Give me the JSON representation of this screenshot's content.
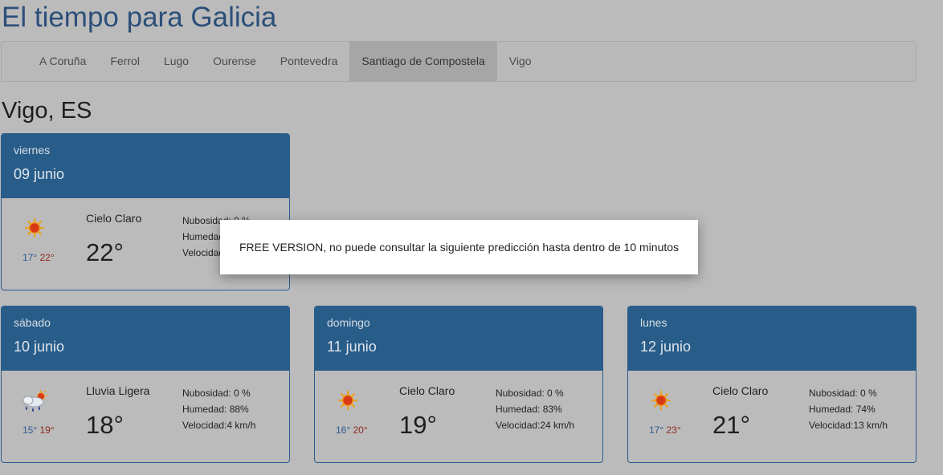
{
  "header": {
    "title": "El tiempo para Galicia"
  },
  "nav": {
    "items": [
      {
        "label": "A Coruña",
        "active": false
      },
      {
        "label": "Ferrol",
        "active": false
      },
      {
        "label": "Lugo",
        "active": false
      },
      {
        "label": "Ourense",
        "active": false
      },
      {
        "label": "Pontevedra",
        "active": false
      },
      {
        "label": "Santiago de Compostela",
        "active": true
      },
      {
        "label": "Vigo",
        "active": false
      }
    ]
  },
  "city": {
    "title": "Vigo, ES"
  },
  "forecast": [
    {
      "weekday": "viernes",
      "date": "09 junio",
      "icon": "sun-icon",
      "min": "17°",
      "max": "22°",
      "condition": "Cielo Claro",
      "temp": "22°",
      "nubosidad": "Nubosidad: 0 %",
      "humedad": "Humedad: ",
      "velocidad": "Velocidad: "
    },
    {
      "weekday": "sábado",
      "date": "10 junio",
      "icon": "rain-icon",
      "min": "15°",
      "max": "19°",
      "condition": "Lluvia Ligera",
      "temp": "18°",
      "nubosidad": "Nubosidad: 0 %",
      "humedad": "Humedad: 88%",
      "velocidad": "Velocidad:4 km/h"
    },
    {
      "weekday": "domingo",
      "date": "11 junio",
      "icon": "sun-icon",
      "min": "16°",
      "max": "20°",
      "condition": "Cielo Claro",
      "temp": "19°",
      "nubosidad": "Nubosidad: 0 %",
      "humedad": "Humedad: 83%",
      "velocidad": "Velocidad:24 km/h"
    },
    {
      "weekday": "lunes",
      "date": "12 junio",
      "icon": "sun-icon",
      "min": "17°",
      "max": "23°",
      "condition": "Cielo Claro",
      "temp": "21°",
      "nubosidad": "Nubosidad: 0 %",
      "humedad": "Humedad: 74%",
      "velocidad": "Velocidad:13 km/h"
    }
  ],
  "modal": {
    "message": "FREE VERSION, no puede consultar la siguiente predicción hasta dentro de 10 minutos"
  }
}
